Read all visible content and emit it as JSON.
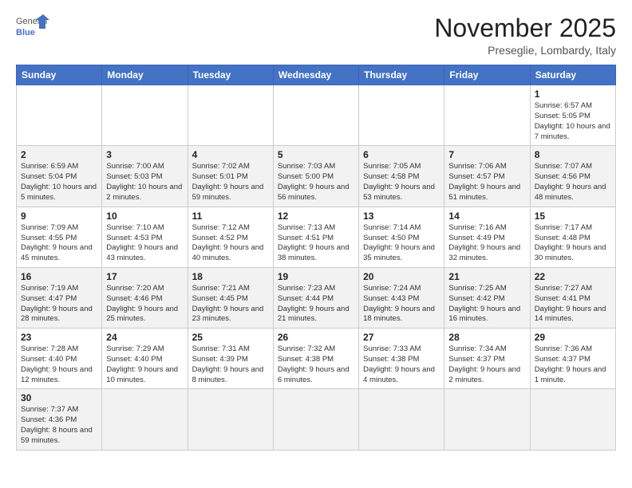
{
  "header": {
    "logo_general": "General",
    "logo_blue": "Blue",
    "month_title": "November 2025",
    "location": "Preseglie, Lombardy, Italy"
  },
  "weekdays": [
    "Sunday",
    "Monday",
    "Tuesday",
    "Wednesday",
    "Thursday",
    "Friday",
    "Saturday"
  ],
  "rows": [
    [
      {
        "day": "",
        "info": ""
      },
      {
        "day": "",
        "info": ""
      },
      {
        "day": "",
        "info": ""
      },
      {
        "day": "",
        "info": ""
      },
      {
        "day": "",
        "info": ""
      },
      {
        "day": "",
        "info": ""
      },
      {
        "day": "1",
        "info": "Sunrise: 6:57 AM\nSunset: 5:05 PM\nDaylight: 10 hours and 7 minutes."
      }
    ],
    [
      {
        "day": "2",
        "info": "Sunrise: 6:59 AM\nSunset: 5:04 PM\nDaylight: 10 hours and 5 minutes."
      },
      {
        "day": "3",
        "info": "Sunrise: 7:00 AM\nSunset: 5:03 PM\nDaylight: 10 hours and 2 minutes."
      },
      {
        "day": "4",
        "info": "Sunrise: 7:02 AM\nSunset: 5:01 PM\nDaylight: 9 hours and 59 minutes."
      },
      {
        "day": "5",
        "info": "Sunrise: 7:03 AM\nSunset: 5:00 PM\nDaylight: 9 hours and 56 minutes."
      },
      {
        "day": "6",
        "info": "Sunrise: 7:05 AM\nSunset: 4:58 PM\nDaylight: 9 hours and 53 minutes."
      },
      {
        "day": "7",
        "info": "Sunrise: 7:06 AM\nSunset: 4:57 PM\nDaylight: 9 hours and 51 minutes."
      },
      {
        "day": "8",
        "info": "Sunrise: 7:07 AM\nSunset: 4:56 PM\nDaylight: 9 hours and 48 minutes."
      }
    ],
    [
      {
        "day": "9",
        "info": "Sunrise: 7:09 AM\nSunset: 4:55 PM\nDaylight: 9 hours and 45 minutes."
      },
      {
        "day": "10",
        "info": "Sunrise: 7:10 AM\nSunset: 4:53 PM\nDaylight: 9 hours and 43 minutes."
      },
      {
        "day": "11",
        "info": "Sunrise: 7:12 AM\nSunset: 4:52 PM\nDaylight: 9 hours and 40 minutes."
      },
      {
        "day": "12",
        "info": "Sunrise: 7:13 AM\nSunset: 4:51 PM\nDaylight: 9 hours and 38 minutes."
      },
      {
        "day": "13",
        "info": "Sunrise: 7:14 AM\nSunset: 4:50 PM\nDaylight: 9 hours and 35 minutes."
      },
      {
        "day": "14",
        "info": "Sunrise: 7:16 AM\nSunset: 4:49 PM\nDaylight: 9 hours and 32 minutes."
      },
      {
        "day": "15",
        "info": "Sunrise: 7:17 AM\nSunset: 4:48 PM\nDaylight: 9 hours and 30 minutes."
      }
    ],
    [
      {
        "day": "16",
        "info": "Sunrise: 7:19 AM\nSunset: 4:47 PM\nDaylight: 9 hours and 28 minutes."
      },
      {
        "day": "17",
        "info": "Sunrise: 7:20 AM\nSunset: 4:46 PM\nDaylight: 9 hours and 25 minutes."
      },
      {
        "day": "18",
        "info": "Sunrise: 7:21 AM\nSunset: 4:45 PM\nDaylight: 9 hours and 23 minutes."
      },
      {
        "day": "19",
        "info": "Sunrise: 7:23 AM\nSunset: 4:44 PM\nDaylight: 9 hours and 21 minutes."
      },
      {
        "day": "20",
        "info": "Sunrise: 7:24 AM\nSunset: 4:43 PM\nDaylight: 9 hours and 18 minutes."
      },
      {
        "day": "21",
        "info": "Sunrise: 7:25 AM\nSunset: 4:42 PM\nDaylight: 9 hours and 16 minutes."
      },
      {
        "day": "22",
        "info": "Sunrise: 7:27 AM\nSunset: 4:41 PM\nDaylight: 9 hours and 14 minutes."
      }
    ],
    [
      {
        "day": "23",
        "info": "Sunrise: 7:28 AM\nSunset: 4:40 PM\nDaylight: 9 hours and 12 minutes."
      },
      {
        "day": "24",
        "info": "Sunrise: 7:29 AM\nSunset: 4:40 PM\nDaylight: 9 hours and 10 minutes."
      },
      {
        "day": "25",
        "info": "Sunrise: 7:31 AM\nSunset: 4:39 PM\nDaylight: 9 hours and 8 minutes."
      },
      {
        "day": "26",
        "info": "Sunrise: 7:32 AM\nSunset: 4:38 PM\nDaylight: 9 hours and 6 minutes."
      },
      {
        "day": "27",
        "info": "Sunrise: 7:33 AM\nSunset: 4:38 PM\nDaylight: 9 hours and 4 minutes."
      },
      {
        "day": "28",
        "info": "Sunrise: 7:34 AM\nSunset: 4:37 PM\nDaylight: 9 hours and 2 minutes."
      },
      {
        "day": "29",
        "info": "Sunrise: 7:36 AM\nSunset: 4:37 PM\nDaylight: 9 hours and 1 minute."
      }
    ],
    [
      {
        "day": "30",
        "info": "Sunrise: 7:37 AM\nSunset: 4:36 PM\nDaylight: 8 hours and 59 minutes."
      },
      {
        "day": "",
        "info": ""
      },
      {
        "day": "",
        "info": ""
      },
      {
        "day": "",
        "info": ""
      },
      {
        "day": "",
        "info": ""
      },
      {
        "day": "",
        "info": ""
      },
      {
        "day": "",
        "info": ""
      }
    ]
  ]
}
